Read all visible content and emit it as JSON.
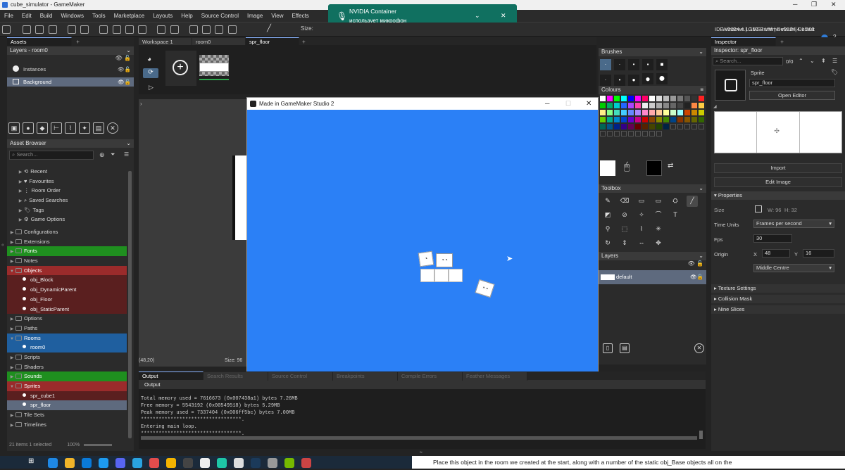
{
  "window": {
    "title": "cube_simulator - GameMaker"
  },
  "menu": [
    "File",
    "Edit",
    "Build",
    "Windows",
    "Tools",
    "Marketplace",
    "Layouts",
    "Help",
    "Source Control",
    "Image",
    "View",
    "Effects"
  ],
  "notification": {
    "title": "NVIDIA Container",
    "body": "использует микрофон"
  },
  "toolbar": {
    "size_label": "Size:",
    "ide_version": "IDE v2024.4.1.152  Runtime v2024.4.1.201",
    "targets": "Windows | GMS2 VM | Default | Default"
  },
  "left": {
    "assets_tab": "Assets",
    "layers_title": "Layers - room0",
    "layers": [
      {
        "name": "Instances"
      },
      {
        "name": "Background"
      }
    ],
    "asset_browser_title": "Asset Browser",
    "search_placeholder": "Search...",
    "quick": [
      "Recent",
      "Favourites",
      "Room Order",
      "Saved Searches",
      "Tags",
      "Game Options"
    ],
    "tree": [
      {
        "name": "Configurations",
        "style": "",
        "indent": 0,
        "kind": "folder"
      },
      {
        "name": "Extensions",
        "style": "",
        "indent": 0,
        "kind": "folder"
      },
      {
        "name": "Fonts",
        "style": "grn",
        "indent": 0,
        "kind": "folder"
      },
      {
        "name": "Notes",
        "style": "",
        "indent": 0,
        "kind": "folder"
      },
      {
        "name": "Objects",
        "style": "red",
        "indent": 0,
        "kind": "open"
      },
      {
        "name": "obj_Block",
        "style": "dkred",
        "indent": 1,
        "kind": "item"
      },
      {
        "name": "obj_DynamicParent",
        "style": "dkred",
        "indent": 1,
        "kind": "item"
      },
      {
        "name": "obj_Floor",
        "style": "dkred",
        "indent": 1,
        "kind": "item"
      },
      {
        "name": "obj_StaticParent",
        "style": "dkred",
        "indent": 1,
        "kind": "item"
      },
      {
        "name": "Options",
        "style": "",
        "indent": 0,
        "kind": "folder"
      },
      {
        "name": "Paths",
        "style": "",
        "indent": 0,
        "kind": "folder"
      },
      {
        "name": "Rooms",
        "style": "blu",
        "indent": 0,
        "kind": "open"
      },
      {
        "name": "room0",
        "style": "blu",
        "indent": 1,
        "kind": "item"
      },
      {
        "name": "Scripts",
        "style": "",
        "indent": 0,
        "kind": "folder"
      },
      {
        "name": "Shaders",
        "style": "",
        "indent": 0,
        "kind": "folder"
      },
      {
        "name": "Sounds",
        "style": "grn",
        "indent": 0,
        "kind": "folder"
      },
      {
        "name": "Sprites",
        "style": "red",
        "indent": 0,
        "kind": "open"
      },
      {
        "name": "spr_cube1",
        "style": "dkred",
        "indent": 1,
        "kind": "item"
      },
      {
        "name": "spr_floor",
        "style": "sel",
        "indent": 1,
        "kind": "item"
      },
      {
        "name": "Tile Sets",
        "style": "",
        "indent": 0,
        "kind": "folder"
      },
      {
        "name": "Timelines",
        "style": "",
        "indent": 0,
        "kind": "folder"
      }
    ],
    "status": "21 items   1 selected",
    "zoom": "100%"
  },
  "center": {
    "tabs": [
      "Workspace 1",
      "room0",
      "spr_floor"
    ],
    "coords": "(48,20)",
    "size_text": "Size: 96"
  },
  "game_window": {
    "title": "Made in GameMaker Studio 2",
    "bg": "#2b80f6"
  },
  "brushes": {
    "title": "Brushes"
  },
  "colours": {
    "title": "Colours",
    "palette": [
      "#ffffff",
      "#ff00ff",
      "#00ff00",
      "#00ffff",
      "#0000ff",
      "#ff00ff",
      "#ff0066",
      "#ffffff",
      "#dddddd",
      "#bbbbbb",
      "#999999",
      "#777777",
      "#555555",
      "#333333",
      "#ff2222",
      "#00cc00",
      "#00aa66",
      "#00cccc",
      "#2266ff",
      "#aa44ff",
      "#ff44aa",
      "#eeeeee",
      "#cccccc",
      "#aaaaaa",
      "#888888",
      "#666666",
      "#444444",
      "#222222",
      "#ff8844",
      "#ffcc44",
      "#ffee88",
      "#88ff88",
      "#44ddbb",
      "#44ccff",
      "#6688ff",
      "#aa88ff",
      "#ff88cc",
      "#ffaaaa",
      "#ffcc99",
      "#ffff99",
      "#ccffcc",
      "#99ffff",
      "#cc4400",
      "#cc8800",
      "#cccc00",
      "#66cc00",
      "#00aa88",
      "#0088cc",
      "#0044cc",
      "#6600cc",
      "#cc0088",
      "#cc0000",
      "#884400",
      "#888800",
      "#448800",
      "#004488",
      "#883300",
      "#885500",
      "#666600",
      "#336600",
      "#006655",
      "#005588",
      "#002288",
      "#330088",
      "#660055",
      "#660000",
      "#552200",
      "#444400",
      "#224400",
      "#002244"
    ]
  },
  "toolbox": {
    "title": "Toolbox"
  },
  "layers_panel": {
    "title": "Layers",
    "layer": "default"
  },
  "output": {
    "tabs": [
      "Output",
      "Search Results",
      "Source Control",
      "Breakpoints",
      "Compile Errors",
      "Feather Messages"
    ],
    "subtitle": "Output",
    "lines": [
      "Total memory used = 7616673 (0x007438a1) bytes 7.26MB",
      "Free memory = 5543192 (0x00549518) bytes 5.29MB",
      "Peak memory used = 7337404 (0x006ff5bc) bytes 7.00MB",
      "**********************************.",
      "Entering main loop.",
      "**********************************."
    ]
  },
  "inspector": {
    "tab": "Inspector",
    "title": "Inspector: spr_floor",
    "search_placeholder": "Search...",
    "count": "0/0",
    "type": "Sprite",
    "name": "spr_floor",
    "open_editor": "Open Editor",
    "import": "Import",
    "edit_image": "Edit Image",
    "properties": "Properties",
    "size_label": "Size",
    "size_w": "W: 96",
    "size_h": "H: 32",
    "time_units_label": "Time Units",
    "time_units": "Frames per second",
    "fps_label": "Fps",
    "fps": "30",
    "origin_label": "Origin",
    "origin_x_label": "X",
    "origin_x": "48",
    "origin_y_label": "Y",
    "origin_y": "16",
    "origin_preset": "Middle Centre",
    "sections": [
      "Texture Settings",
      "Collision Mask",
      "Nine Slices"
    ]
  },
  "taskbar": {
    "tutorial_text": "Place this object in the room we created at the start, along with a number of the static obj_Base objects all on the"
  }
}
